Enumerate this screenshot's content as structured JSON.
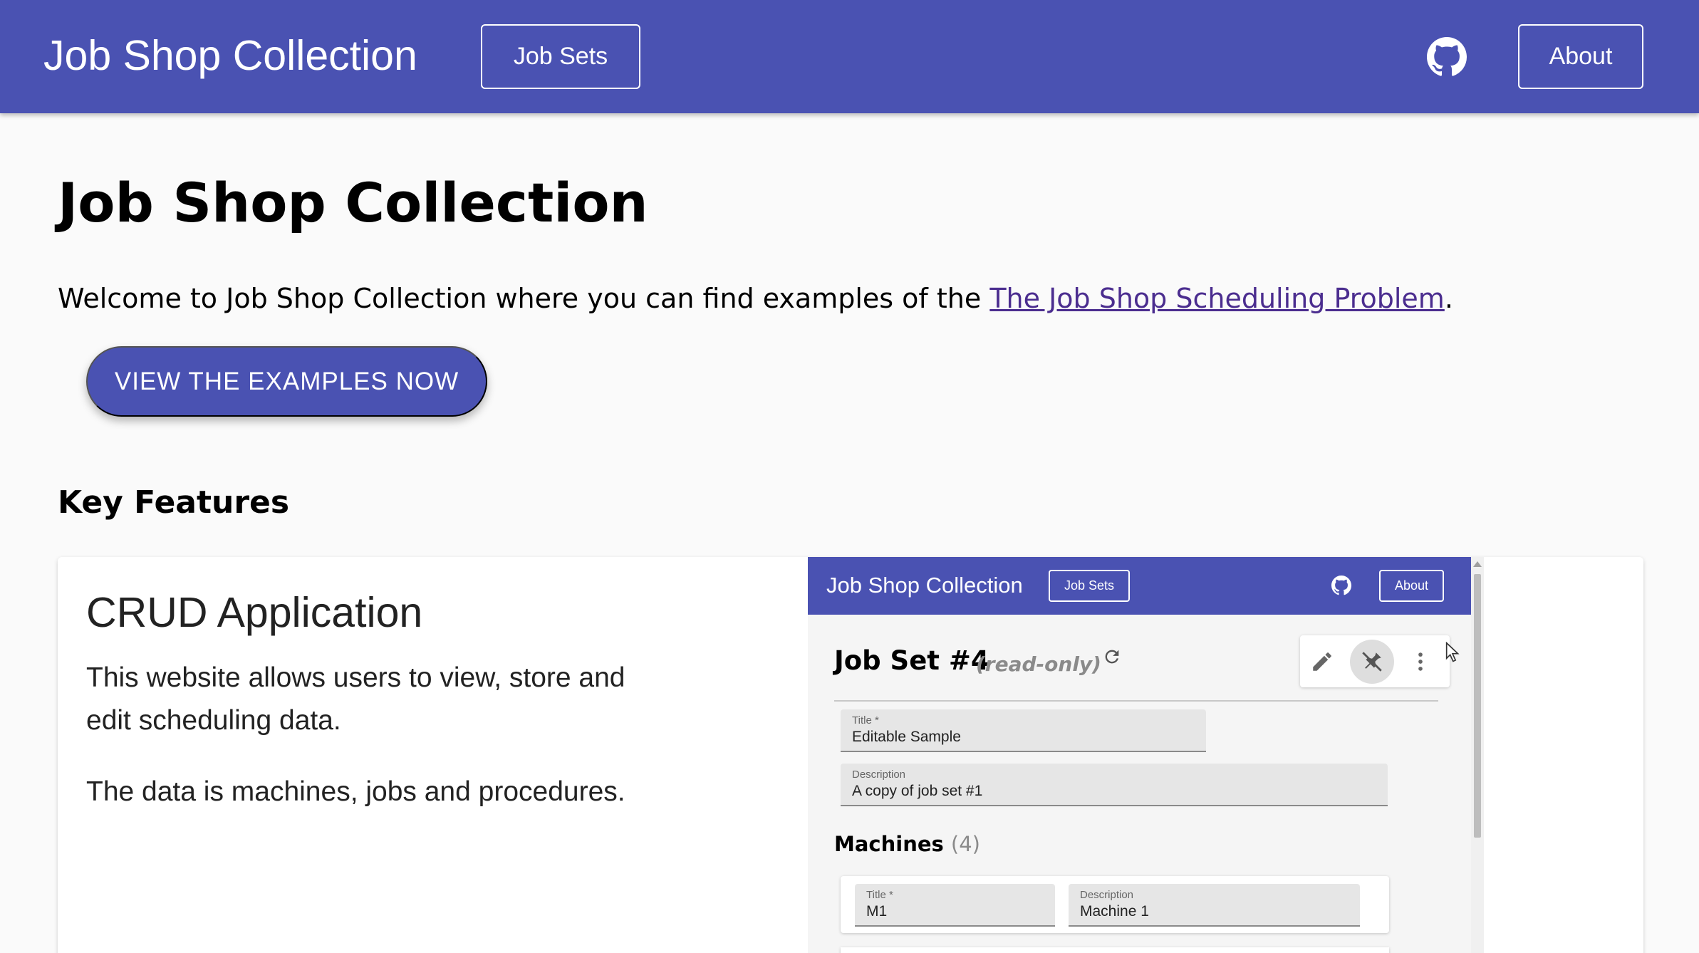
{
  "appbar": {
    "brand": "Job Shop Collection",
    "job_sets_label": "Job Sets",
    "about_label": "About",
    "github_icon": "github-icon"
  },
  "main": {
    "title": "Job Shop Collection",
    "welcome_prefix": "Welcome to Job Shop Collection where you can find examples of the ",
    "welcome_link": "The Job Shop Scheduling Problem",
    "welcome_suffix": ".",
    "cta_label": "VIEW THE EXAMPLES NOW",
    "section_title": "Key Features"
  },
  "feature_card": {
    "title": "CRUD Application",
    "paragraph1": "This website allows users to view, store and edit scheduling data.",
    "paragraph2": "The data is machines, jobs and procedures."
  },
  "screenshot": {
    "brand": "Job Shop Collection",
    "job_sets_label": "Job Sets",
    "about_label": "About",
    "job_set_title": "Job Set #4",
    "read_only": "(read-only)",
    "fields": {
      "title_label": "Title *",
      "title_value": "Editable Sample",
      "description_label": "Description",
      "description_value": "A copy of job set #1"
    },
    "machines_label": "Machines",
    "machines_count": "(4)",
    "machine1": {
      "title_label": "Title *",
      "title_value": "M1",
      "description_label": "Description",
      "description_value": "Machine 1"
    }
  },
  "colors": {
    "primary": "#4a52b2",
    "background": "#fafafa",
    "link": "#4b2d8f"
  }
}
